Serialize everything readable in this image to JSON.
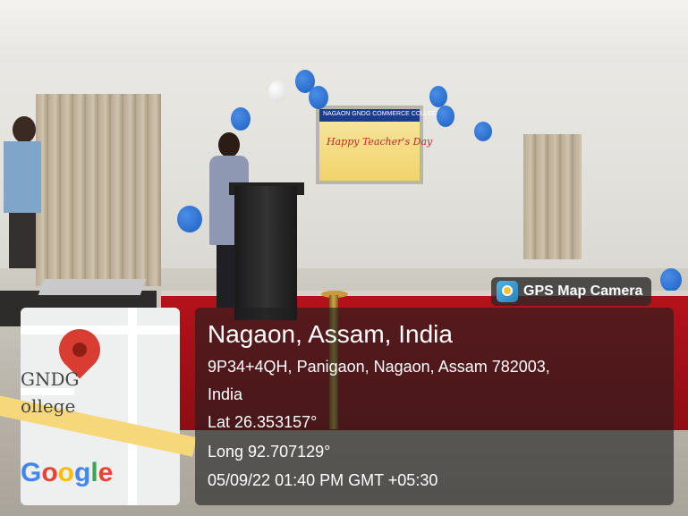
{
  "app": {
    "badge_label": "GPS Map Camera",
    "badge_icon": "gps-map-camera-icon"
  },
  "map": {
    "place_labels": [
      "GNDG",
      "ollege"
    ],
    "logo": "Google",
    "pin_color": "#d93d32"
  },
  "location": {
    "title": "Nagaon, Assam, India",
    "address_line_1": "9P34+4QH, Panigaon, Nagaon, Assam 782003,",
    "address_line_2": "India",
    "lat": "Lat 26.353157°",
    "long": "Long 92.707129°",
    "datetime": "05/09/22 01:40 PM GMT +05:30"
  },
  "scene": {
    "banner_heading": "NAGAON GNDG COMMERCE COLLEGE",
    "banner_text": "Happy Teacher's Day"
  }
}
